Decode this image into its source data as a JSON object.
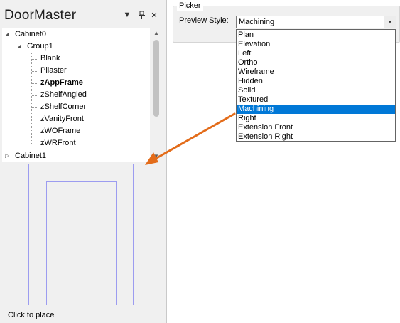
{
  "panel": {
    "title": "DoorMaster",
    "pin_glyph": "▾",
    "pushpin_glyph": "ᵖ",
    "close_glyph": "✕"
  },
  "tree": {
    "cabinet0": "Cabinet0",
    "group1": "Group1",
    "leaves": [
      "Blank",
      "Pilaster",
      "zAppFrame",
      "zShelfAngled",
      "zShelfCorner",
      "zVanityFront",
      "zWOFrame",
      "zWRFront"
    ],
    "selected_leaf": "zAppFrame",
    "cabinet1": "Cabinet1",
    "expanded_glyph": "◢",
    "collapsed_glyph": "▷"
  },
  "status": {
    "text": "Click to place"
  },
  "picker": {
    "legend": "Picker",
    "preview_style_label": "Preview Style:",
    "value": "Machining",
    "options": [
      "Plan",
      "Elevation",
      "Left",
      "Ortho",
      "Wireframe",
      "Hidden",
      "Solid",
      "Textured",
      "Machining",
      "Right",
      "Extension Front",
      "Extension Right"
    ],
    "selected_index": 8
  },
  "colors": {
    "selection": "#0078d7",
    "annotation_arrow": "#e36c1a",
    "preview_stroke": "#9c9cf0"
  }
}
